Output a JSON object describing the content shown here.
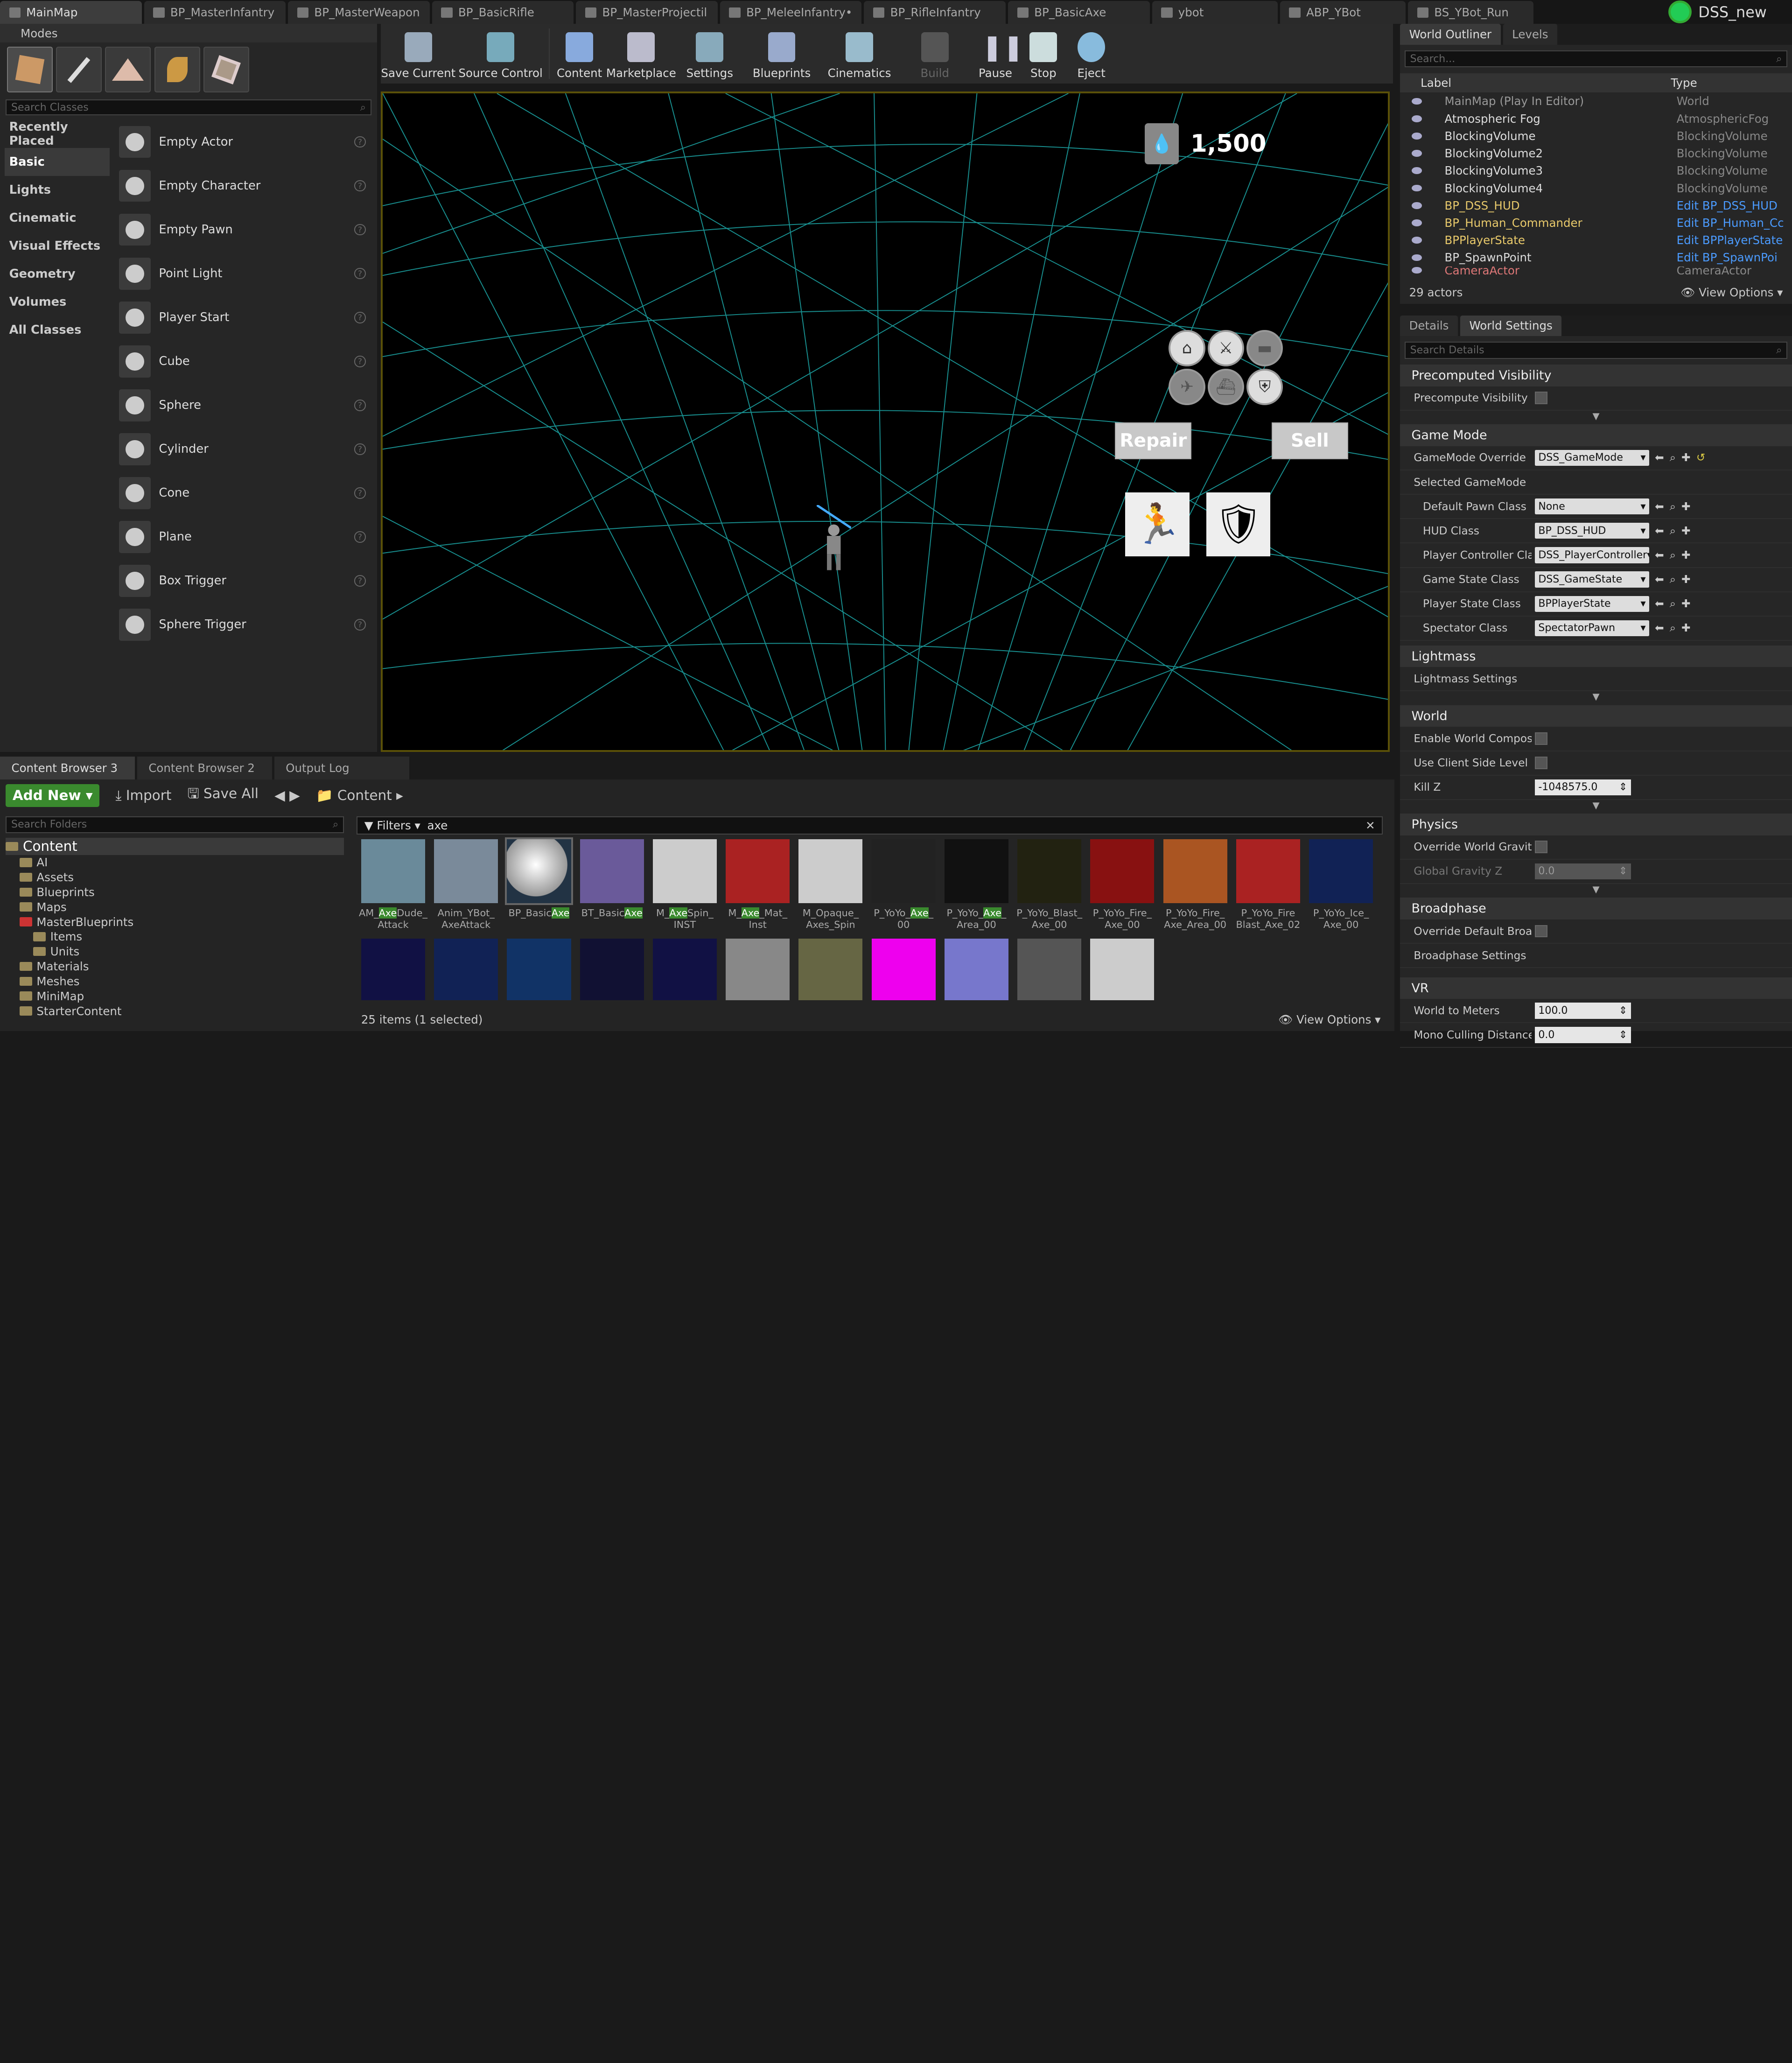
{
  "tabs": [
    "MainMap",
    "BP_MasterInfantry",
    "BP_MasterWeapon",
    "BP_BasicRifle",
    "BP_MasterProjectil",
    "BP_MeleeInfantry•",
    "BP_RifleInfantry",
    "BP_BasicAxe",
    "ybot",
    "ABP_YBot",
    "BS_YBot_Run"
  ],
  "project_name": "DSS_new",
  "modes": {
    "title": "Modes",
    "search_placeholder": "Search Classes",
    "categories": [
      "Recently Placed",
      "Basic",
      "Lights",
      "Cinematic",
      "Visual Effects",
      "Geometry",
      "Volumes",
      "All Classes"
    ],
    "items": [
      "Empty Actor",
      "Empty Character",
      "Empty Pawn",
      "Point Light",
      "Player Start",
      "Cube",
      "Sphere",
      "Cylinder",
      "Cone",
      "Plane",
      "Box Trigger",
      "Sphere Trigger"
    ]
  },
  "toolbar": [
    "Save Current",
    "Source Control",
    "Content",
    "Marketplace",
    "Settings",
    "Blueprints",
    "Cinematics",
    "Build",
    "Pause",
    "Stop",
    "Eject"
  ],
  "viewport": {
    "resource_value": "1,500",
    "repair_label": "Repair",
    "sell_label": "Sell"
  },
  "outliner": {
    "tab1": "World Outliner",
    "tab2": "Levels",
    "search_placeholder": "Search...",
    "col_label": "Label",
    "col_type": "Type",
    "rows": [
      {
        "name": "MainMap (Play In Editor)",
        "type": "World"
      },
      {
        "name": "Atmospheric Fog",
        "type": "AtmosphericFog"
      },
      {
        "name": "BlockingVolume",
        "type": "BlockingVolume"
      },
      {
        "name": "BlockingVolume2",
        "type": "BlockingVolume"
      },
      {
        "name": "BlockingVolume3",
        "type": "BlockingVolume"
      },
      {
        "name": "BlockingVolume4",
        "type": "BlockingVolume"
      },
      {
        "name": "BP_DSS_HUD",
        "type": "Edit BP_DSS_HUD"
      },
      {
        "name": "BP_Human_Commander",
        "type": "Edit BP_Human_Cc"
      },
      {
        "name": "BPPlayerState",
        "type": "Edit BPPlayerState"
      },
      {
        "name": "BP_SpawnPoint",
        "type": "Edit BP_SpawnPoi"
      },
      {
        "name": "CameraActor",
        "type": "CameraActor"
      }
    ],
    "count": "29 actors",
    "view_options": "View Options"
  },
  "details": {
    "tab1": "Details",
    "tab2": "World Settings",
    "search_placeholder": "Search Details",
    "precomputed": "Precomputed Visibility",
    "precompute_label": "Precompute Visibility",
    "game_mode": "Game Mode",
    "gm_override_label": "GameMode Override",
    "gm_override": "DSS_GameMode",
    "selected_gm": "Selected GameMode",
    "default_pawn_label": "Default Pawn Class",
    "default_pawn": "None",
    "hud_label": "HUD Class",
    "hud": "BP_DSS_HUD",
    "pc_label": "Player Controller Class",
    "pc": "DSS_PlayerController",
    "gs_label": "Game State Class",
    "gs": "DSS_GameState",
    "ps_label": "Player State Class",
    "ps": "BPPlayerState",
    "spec_label": "Spectator Class",
    "spec": "SpectatorPawn",
    "lightmass": "Lightmass",
    "lightmass_settings": "Lightmass Settings",
    "world": "World",
    "enable_comp": "Enable World Compositio",
    "client_side": "Use Client Side Level Str",
    "killz_label": "Kill Z",
    "killz": "-1048575.0",
    "physics": "Physics",
    "override_gravity": "Override World Gravity",
    "global_gravity_label": "Global Gravity Z",
    "global_gravity": "0.0",
    "broadphase": "Broadphase",
    "override_bp": "Override Default Broadph",
    "bp_settings": "Broadphase Settings",
    "vr": "VR",
    "wtm_label": "World to Meters",
    "wtm": "100.0",
    "mono_label": "Mono Culling Distance",
    "mono": "0.0"
  },
  "content": {
    "tabs": [
      "Content Browser 3",
      "Content Browser 2",
      "Output Log"
    ],
    "add_new": "Add New",
    "import": "Import",
    "save_all": "Save All",
    "path": "Content",
    "folder_search": "Search Folders",
    "filters": "Filters",
    "filter_text": "axe",
    "folders": [
      "Content",
      "AI",
      "Assets",
      "Blueprints",
      "Maps",
      "MasterBlueprints",
      "Items",
      "Units",
      "Materials",
      "Meshes",
      "MiniMap",
      "StarterContent"
    ],
    "assets": [
      {
        "a": "AM_",
        "h": "Axe",
        "b": "Dude_",
        "c": "Attack"
      },
      {
        "a": "Anim_YBot_",
        "h": "",
        "b": "",
        "c": "AxeAttack"
      },
      {
        "a": "BP_Basic",
        "h": "Axe",
        "b": "",
        "c": ""
      },
      {
        "a": "BT_Basic",
        "h": "Axe",
        "b": "",
        "c": ""
      },
      {
        "a": "M_",
        "h": "Axe",
        "b": "Spin_",
        "c": "INST"
      },
      {
        "a": "M_",
        "h": "Axe",
        "b": "_Mat_",
        "c": "Inst"
      },
      {
        "a": "M_Opaque_",
        "h": "",
        "b": "",
        "c": "Axes_Spin"
      },
      {
        "a": "P_YoYo_",
        "h": "Axe",
        "b": "_",
        "c": "00"
      },
      {
        "a": "P_YoYo_",
        "h": "Axe",
        "b": "_",
        "c": "Area_00"
      },
      {
        "a": "P_YoYo_Blast_",
        "h": "",
        "b": "",
        "c": "Axe_00"
      },
      {
        "a": "P_YoYo_Fire_",
        "h": "",
        "b": "",
        "c": "Axe_00"
      },
      {
        "a": "P_YoYo_Fire_",
        "h": "",
        "b": "",
        "c": "Axe_Area_00"
      },
      {
        "a": "P_YoYo_Fire",
        "h": "",
        "b": "",
        "c": "Blast_Axe_02"
      },
      {
        "a": "P_YoYo_Ice_",
        "h": "",
        "b": "",
        "c": "Axe_00"
      }
    ],
    "count": "25 items (1 selected)",
    "view_options": "View Options"
  }
}
